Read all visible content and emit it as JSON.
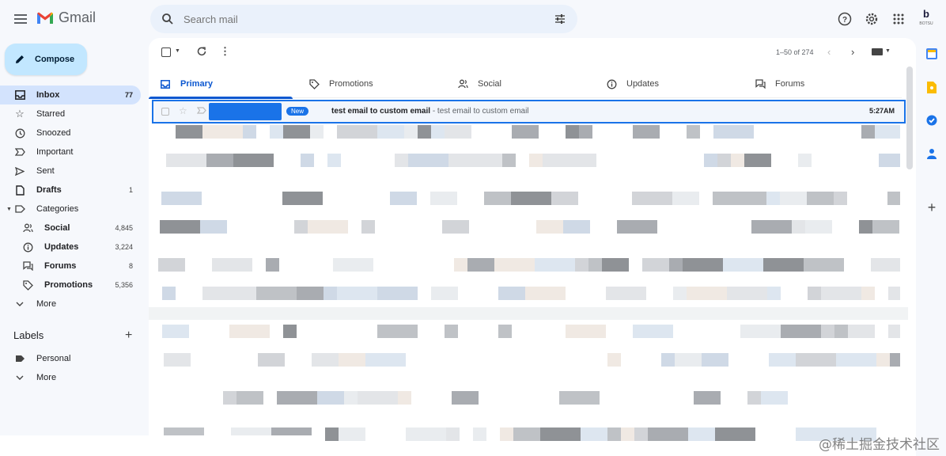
{
  "header": {
    "app_name": "Gmail",
    "search_placeholder": "Search mail",
    "profile_initial": "b",
    "profile_subtitle": "BOTSU"
  },
  "sidebar": {
    "compose_label": "Compose",
    "items": [
      {
        "label": "Inbox",
        "count": "77",
        "icon": "inbox-icon"
      },
      {
        "label": "Starred",
        "count": "",
        "icon": "star-icon"
      },
      {
        "label": "Snoozed",
        "count": "",
        "icon": "clock-icon"
      },
      {
        "label": "Important",
        "count": "",
        "icon": "important-icon"
      },
      {
        "label": "Sent",
        "count": "",
        "icon": "send-icon"
      },
      {
        "label": "Drafts",
        "count": "1",
        "icon": "draft-icon"
      },
      {
        "label": "Categories",
        "count": "",
        "icon": "label-icon"
      },
      {
        "label": "Social",
        "count": "4,845",
        "icon": "social-icon"
      },
      {
        "label": "Updates",
        "count": "3,224",
        "icon": "info-icon"
      },
      {
        "label": "Forums",
        "count": "8",
        "icon": "forum-icon"
      },
      {
        "label": "Promotions",
        "count": "5,356",
        "icon": "tag-icon"
      },
      {
        "label": "More",
        "count": "",
        "icon": "chevron-down-icon"
      }
    ],
    "labels_title": "Labels",
    "labels": [
      {
        "label": "Personal",
        "icon": "label-filled-icon"
      },
      {
        "label": "More",
        "icon": "chevron-down-icon"
      }
    ]
  },
  "toolbar": {
    "pagination": "1–50 of 274"
  },
  "tabs": [
    {
      "label": "Primary",
      "icon": "inbox-icon"
    },
    {
      "label": "Promotions",
      "icon": "tag-icon"
    },
    {
      "label": "Social",
      "icon": "social-icon"
    },
    {
      "label": "Updates",
      "icon": "info-icon"
    },
    {
      "label": "Forums",
      "icon": "forum-icon"
    }
  ],
  "email": {
    "badge": "New",
    "subject": "test email to custom email",
    "snippet": " - test email to custom email",
    "time": "5:27AM"
  },
  "watermark": "@稀土掘金技术社区",
  "colors": {
    "accent": "#0b57d0",
    "highlight_border": "#1a73e8",
    "compose_bg": "#c2e7ff",
    "active_nav_bg": "#d3e3fd"
  }
}
